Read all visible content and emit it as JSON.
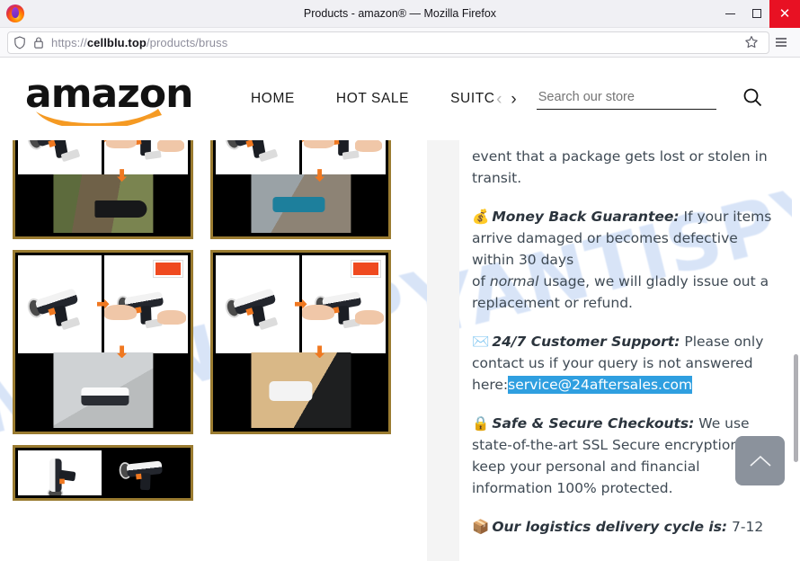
{
  "browser": {
    "window_title": "Products - amazon® — Mozilla Firefox",
    "logo_icon": "firefox-logo",
    "minimize_label": "Minimize",
    "maximize_label": "Maximize",
    "close_label": "Close",
    "url_scheme": "https://",
    "url_domain": "cellblu.top",
    "url_path": "/products/bruss",
    "shield_icon": "shield-icon",
    "lock_icon": "lock-icon",
    "bookmark_icon": "star-icon",
    "menu_icon": "hamburger-menu-icon"
  },
  "store": {
    "logo_text": "amazon",
    "nav": [
      {
        "label": "HOME"
      },
      {
        "label": "HOT SALE"
      },
      {
        "label": "SUITCAS"
      }
    ],
    "prev_arrow": "‹",
    "next_arrow": "›",
    "search": {
      "placeholder": "Search our store",
      "value": "",
      "icon": "search-icon"
    }
  },
  "watermark": "MYANTISPYWARE.COM",
  "gallery": {
    "rows": [
      {
        "tiles": [
          {
            "alt": "cordless-tool-step-photos-1"
          },
          {
            "alt": "cordless-tool-step-photos-2"
          }
        ]
      },
      {
        "tiles": [
          {
            "alt": "cordless-tool-step-photos-3"
          },
          {
            "alt": "cordless-tool-step-photos-4"
          }
        ]
      },
      {
        "tiles": [
          {
            "alt": "cordless-tool-step-photos-5"
          }
        ]
      }
    ]
  },
  "details": {
    "paragraphs": [
      {
        "id": "lost-in-transit",
        "emoji": "",
        "heading": "",
        "text": "event that a package gets lost or stolen in transit."
      },
      {
        "id": "money-back",
        "emoji": "💰",
        "heading": "Money Back Guarantee:",
        "text": " If your items arrive damaged or becomes defective within 30 days",
        "text_line2_pre": "of ",
        "text_italic": "normal",
        "text_line2_post": " usage, we will gladly issue out a replacement or refund."
      },
      {
        "id": "customer-support",
        "emoji": "✉️",
        "heading": "24/7 Customer Support:",
        "text": " Please only contact us if your query is not answered here:",
        "email": "service@24aftersales.com"
      },
      {
        "id": "secure-checkout",
        "emoji": "🔒",
        "heading": "Safe & Secure Checkouts:",
        "text": " We use state-of-the-art SSL Secure encryption to keep your personal and financial information 100% protected."
      },
      {
        "id": "logistics",
        "emoji": "📦",
        "heading": "Our logistics delivery cycle is:",
        "text": " 7-12"
      }
    ]
  },
  "controls": {
    "scroll_top_icon": "chevron-up-icon",
    "scroll_top_label": "Back to top"
  },
  "colors": {
    "accent_orange": "#f0a030",
    "selection_blue": "#2f9fe0",
    "close_red": "#e81123",
    "scroll_top_gray": "#8b929c",
    "watermark_blue": "#a9c4ef"
  }
}
